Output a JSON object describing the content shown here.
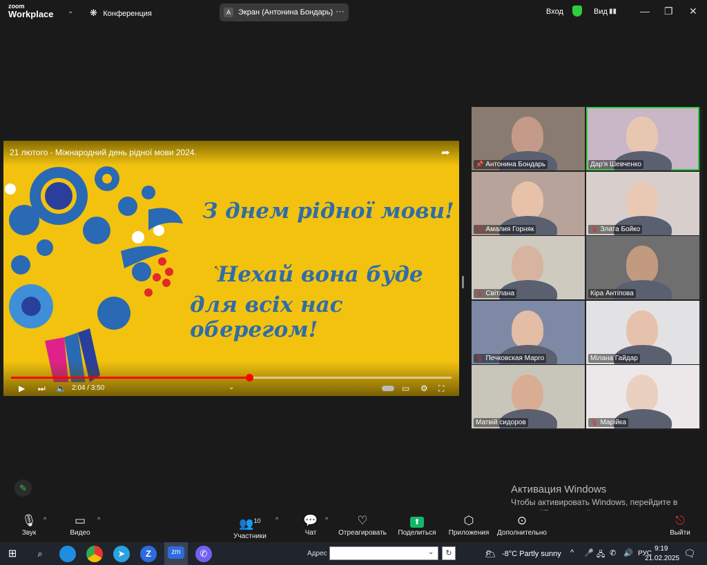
{
  "titlebar": {
    "logo_top": "zoom",
    "logo_bottom": "Workplace",
    "meeting_label": "Конференция",
    "share_avatar": "A",
    "share_title": "Экран (Антонина Бондарь)",
    "signin": "Вход",
    "view": "Вид"
  },
  "video": {
    "title": "21 лютого - Міжнародний день рідної мови 2024.",
    "greeting_line1": "З днем рідної мови!",
    "greeting_line2": "Нехай вона буде",
    "greeting_line3": "для всіх нас оберегом!",
    "time": "2:04 / 3:50",
    "progress": 0.54
  },
  "participants": [
    {
      "name": "Антонина Бондарь",
      "muted": false,
      "pinned": true
    },
    {
      "name": "Дар'я Шевченко",
      "muted": false,
      "pinned": false
    },
    {
      "name": "Амалия Горняк",
      "muted": true,
      "pinned": false
    },
    {
      "name": "Злата Бойко",
      "muted": true,
      "pinned": false
    },
    {
      "name": "Світлана",
      "muted": true,
      "pinned": false
    },
    {
      "name": "Кіра Антіпова",
      "muted": false,
      "pinned": false
    },
    {
      "name": "Печковская Марго",
      "muted": true,
      "pinned": false
    },
    {
      "name": "Мілана Гайдар",
      "muted": false,
      "pinned": false
    },
    {
      "name": "Матвій сидоров",
      "muted": false,
      "pinned": false
    },
    {
      "name": "Марійка",
      "muted": true,
      "pinned": false
    }
  ],
  "activation": {
    "title": "Активация Windows",
    "text": "Чтобы активировать Windows, перейдите в раздел \"Параметры\"."
  },
  "toolbar": {
    "audio": "Звук",
    "video": "Видео",
    "participants": "Участники",
    "participants_count": "10",
    "chat": "Чат",
    "react": "Отреагировать",
    "share": "Поделиться",
    "apps": "Приложения",
    "more": "Дополнительно",
    "leave": "Выйти"
  },
  "taskbar": {
    "address_label": "Адрес",
    "address_value": "",
    "weather": "-8°C  Partly sunny",
    "lang": "РУС",
    "time": "9:19",
    "date": "21.02.2025"
  },
  "colors": {
    "accent_green": "#2ecc40",
    "share_green": "#12b76a",
    "leave_red": "#e02b2b",
    "video_bg": "#f2c20f",
    "greeting_blue": "#2f6da8"
  }
}
